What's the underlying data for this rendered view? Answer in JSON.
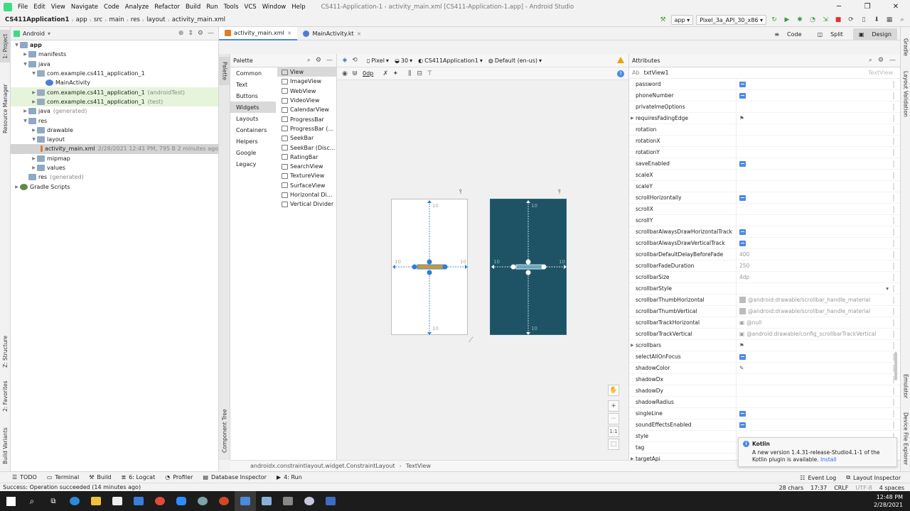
{
  "window": {
    "menus": [
      "File",
      "Edit",
      "View",
      "Navigate",
      "Code",
      "Analyze",
      "Refactor",
      "Build",
      "Run",
      "Tools",
      "VCS",
      "Window",
      "Help"
    ],
    "title": "CS411-Application-1 - activity_main.xml [CS411-Application-1.app] - Android Studio"
  },
  "navbar": {
    "crumbs": [
      "CS411Application1",
      "app",
      "src",
      "main",
      "res",
      "layout",
      "activity_main.xml"
    ],
    "run_config": "app",
    "device": "Pixel_3a_API_30_x86"
  },
  "leftstrip": {
    "project": "1: Project",
    "resource_manager": "Resource Manager",
    "structure": "Z: Structure",
    "favorites": "2: Favorites",
    "build_variants": "Build Variants"
  },
  "rightstrip": {
    "gradle": "Gradle",
    "layout_validation": "Layout Validation",
    "emulator": "Emulator",
    "device_file_explorer": "Device File Explorer"
  },
  "project": {
    "view_mode": "Android",
    "tree": [
      {
        "label": "app",
        "extra": "",
        "indent": 0,
        "arrow": "▼",
        "icon": "folder",
        "bold": true
      },
      {
        "label": "manifests",
        "extra": "",
        "indent": 1,
        "arrow": "▶",
        "icon": "folder"
      },
      {
        "label": "java",
        "extra": "",
        "indent": 1,
        "arrow": "▼",
        "icon": "folder"
      },
      {
        "label": "com.example.cs411_application_1",
        "extra": "",
        "indent": 2,
        "arrow": "▼",
        "icon": "pkg"
      },
      {
        "label": "MainActivity",
        "extra": "",
        "indent": 3,
        "arrow": "",
        "icon": "kt"
      },
      {
        "label": "com.example.cs411_application_1",
        "extra": "(androidTest)",
        "indent": 2,
        "arrow": "▶",
        "icon": "pkg",
        "hl": true
      },
      {
        "label": "com.example.cs411_application_1",
        "extra": "(test)",
        "indent": 2,
        "arrow": "▶",
        "icon": "pkg",
        "hl": true
      },
      {
        "label": "java",
        "extra": "(generated)",
        "indent": 1,
        "arrow": "▶",
        "icon": "folder"
      },
      {
        "label": "res",
        "extra": "",
        "indent": 1,
        "arrow": "▼",
        "icon": "folder"
      },
      {
        "label": "drawable",
        "extra": "",
        "indent": 2,
        "arrow": "▶",
        "icon": "folder"
      },
      {
        "label": "layout",
        "extra": "",
        "indent": 2,
        "arrow": "▼",
        "icon": "folder"
      },
      {
        "label": "activity_main.xml",
        "extra": "2/28/2021 12:41 PM, 795 B 2 minutes ago",
        "indent": 3,
        "arrow": "",
        "icon": "xml",
        "sel": true
      },
      {
        "label": "mipmap",
        "extra": "",
        "indent": 2,
        "arrow": "▶",
        "icon": "folder"
      },
      {
        "label": "values",
        "extra": "",
        "indent": 2,
        "arrow": "▶",
        "icon": "folder"
      },
      {
        "label": "res",
        "extra": "(generated)",
        "indent": 1,
        "arrow": "",
        "icon": "folder"
      },
      {
        "label": "Gradle Scripts",
        "extra": "",
        "indent": 0,
        "arrow": "▶",
        "icon": "grad"
      }
    ]
  },
  "editor_tabs": [
    {
      "label": "activity_main.xml",
      "active": true,
      "icon": "xml"
    },
    {
      "label": "MainActivity.kt",
      "active": false,
      "icon": "kt"
    }
  ],
  "view_modes": {
    "code": "Code",
    "split": "Split",
    "design": "Design"
  },
  "palette": {
    "title": "Palette",
    "strip_label": "Palette",
    "component_tree_label": "Component Tree",
    "categories": [
      "Common",
      "Text",
      "Buttons",
      "Widgets",
      "Layouts",
      "Containers",
      "Helpers",
      "Google",
      "Legacy"
    ],
    "selected_category": "Widgets",
    "items": [
      "View",
      "ImageView",
      "WebView",
      "VideoView",
      "CalendarView",
      "ProgressBar",
      "ProgressBar (...",
      "SeekBar",
      "SeekBar (Disc...",
      "RatingBar",
      "SearchView",
      "TextureView",
      "SurfaceView",
      "Horizontal Di...",
      "Vertical Divider"
    ],
    "selected_item": "View"
  },
  "design_toolbar": {
    "device": "Pixel",
    "api": "30",
    "theme": "CS411Application1",
    "locale": "Default (en-us)",
    "margin": "0dp"
  },
  "blueprint": {
    "margin_labels": [
      "10",
      "10",
      "10",
      "10"
    ]
  },
  "zoom": {
    "fit_label": "1:1"
  },
  "path": {
    "layout": "androidx.constraintlayout.widget.ConstraintLayout",
    "widget": "TextView"
  },
  "attributes": {
    "title": "Attributes",
    "id_label": "Ab",
    "id_value": "txtView1",
    "type": "TextView",
    "rows": [
      {
        "name": "password",
        "kind": "flag"
      },
      {
        "name": "phoneNumber",
        "kind": "flag"
      },
      {
        "name": "privateImeOptions",
        "kind": "none"
      },
      {
        "name": "requiresFadingEdge",
        "kind": "pin",
        "expand": true
      },
      {
        "name": "rotation",
        "kind": "none"
      },
      {
        "name": "rotationX",
        "kind": "none"
      },
      {
        "name": "rotationY",
        "kind": "none"
      },
      {
        "name": "saveEnabled",
        "kind": "flag"
      },
      {
        "name": "scaleX",
        "kind": "none"
      },
      {
        "name": "scaleY",
        "kind": "none"
      },
      {
        "name": "scrollHorizontally",
        "kind": "flag"
      },
      {
        "name": "scrollX",
        "kind": "none"
      },
      {
        "name": "scrollY",
        "kind": "none"
      },
      {
        "name": "scrollbarAlwaysDrawHorizontalTrack",
        "kind": "flag"
      },
      {
        "name": "scrollbarAlwaysDrawVerticalTrack",
        "kind": "flag"
      },
      {
        "name": "scrollbarDefaultDelayBeforeFade",
        "kind": "text",
        "value": "400"
      },
      {
        "name": "scrollbarFadeDuration",
        "kind": "text",
        "value": "250"
      },
      {
        "name": "scrollbarSize",
        "kind": "text",
        "value": "4dp"
      },
      {
        "name": "scrollbarStyle",
        "kind": "dropdown"
      },
      {
        "name": "scrollbarThumbHorizontal",
        "kind": "swatch",
        "value": "@android:drawable/scrollbar_handle_material"
      },
      {
        "name": "scrollbarThumbVertical",
        "kind": "swatch",
        "value": "@android:drawable/scrollbar_handle_material"
      },
      {
        "name": "scrollbarTrackHorizontal",
        "kind": "img",
        "value": "@null"
      },
      {
        "name": "scrollbarTrackVertical",
        "kind": "img",
        "value": "@android:drawable/config_scrollbarTrackVertical"
      },
      {
        "name": "scrollbars",
        "kind": "pin",
        "expand": true
      },
      {
        "name": "selectAllOnFocus",
        "kind": "flag"
      },
      {
        "name": "shadowColor",
        "kind": "pick"
      },
      {
        "name": "shadowDx",
        "kind": "none"
      },
      {
        "name": "shadowDy",
        "kind": "none"
      },
      {
        "name": "shadowRadius",
        "kind": "none"
      },
      {
        "name": "singleLine",
        "kind": "flag"
      },
      {
        "name": "soundEffectsEnabled",
        "kind": "flag"
      },
      {
        "name": "style",
        "kind": "none"
      },
      {
        "name": "tag",
        "kind": "none"
      },
      {
        "name": "targetApi",
        "kind": "none",
        "expand": true
      }
    ]
  },
  "notification": {
    "title": "Kotlin",
    "body": "A new version 1.4.31-release-Studio4.1-1 of the Kotlin plugin is available.",
    "link": "Install"
  },
  "toolwindows": [
    "TODO",
    "Terminal",
    "Build",
    "6: Logcat",
    "Profiler",
    "Database Inspector",
    "4: Run"
  ],
  "toolwindows_right": [
    "Event Log",
    "Layout Inspector"
  ],
  "status": {
    "message": "Success: Operation succeeded (14 minutes ago)",
    "chars": "28 chars",
    "position": "17:37",
    "line_sep": "CRLF",
    "encoding": "UTF-8",
    "indent": "4 spaces"
  },
  "clock": {
    "time": "12:48 PM",
    "date": "2/28/2021"
  },
  "colors": {
    "accent": "#4a88e8",
    "blueprint": "#1e5366",
    "selection": "#c99a2e"
  }
}
